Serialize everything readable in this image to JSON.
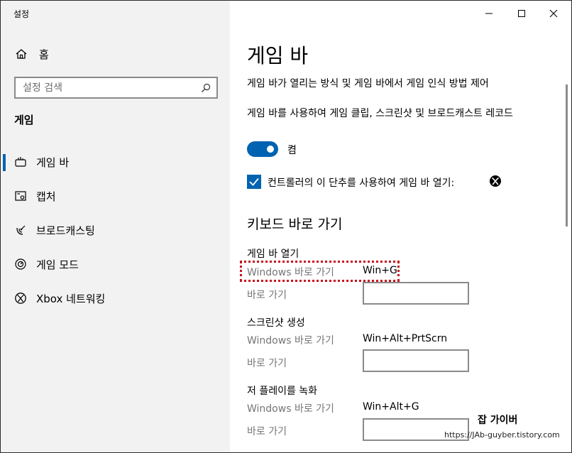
{
  "window": {
    "app_title": "설정",
    "controls": [
      "minimize-icon",
      "maximize-icon",
      "close-icon"
    ]
  },
  "sidebar": {
    "home_label": "홈",
    "search": {
      "placeholder": "설정 검색",
      "value": ""
    },
    "section_title": "게임",
    "items": [
      {
        "label": "게임 바",
        "icon": "game-bar-icon",
        "selected": true
      },
      {
        "label": "캡처",
        "icon": "capture-icon",
        "selected": false
      },
      {
        "label": "브로드캐스팅",
        "icon": "broadcast-icon",
        "selected": false
      },
      {
        "label": "게임 모드",
        "icon": "game-mode-icon",
        "selected": false
      },
      {
        "label": "Xbox 네트워킹",
        "icon": "xbox-icon",
        "selected": false
      }
    ]
  },
  "main": {
    "title": "게임 바",
    "description": "게임 바가 열리는 방식 및 게임 바에서 게임 인식 방법 제어",
    "record_text": "게임 바를 사용하여 게임 클립, 스크린샷 및 브로드캐스트 레코드",
    "toggle": {
      "on": true,
      "label": "켬"
    },
    "controller_checkbox": {
      "checked": true,
      "label": "컨트롤러의 이 단추를 사용하여 게임 바 열기:"
    },
    "shortcuts_title": "키보드 바로 가기",
    "shortcut_groups": [
      {
        "title": "게임 바 열기",
        "windows_label": "Windows 바로 가기",
        "windows_value": "Win+G",
        "custom_label": "바로 가기",
        "custom_value": ""
      },
      {
        "title": "스크린샷 생성",
        "windows_label": "Windows 바로 가기",
        "windows_value": "Win+Alt+PrtScrn",
        "custom_label": "바로 가기",
        "custom_value": ""
      },
      {
        "title": "저 플레이를 녹화",
        "windows_label": "Windows 바로 가기",
        "windows_value": "Win+Alt+G",
        "custom_label": "바로 가기",
        "custom_value": ""
      }
    ]
  },
  "watermark": {
    "brand": "잡 가이버",
    "url": "https://JAb-guyber.tistory.com"
  },
  "colors": {
    "accent": "#0063b1",
    "sidebar_bg": "#f2f2f2",
    "highlight": "#c8101c"
  }
}
